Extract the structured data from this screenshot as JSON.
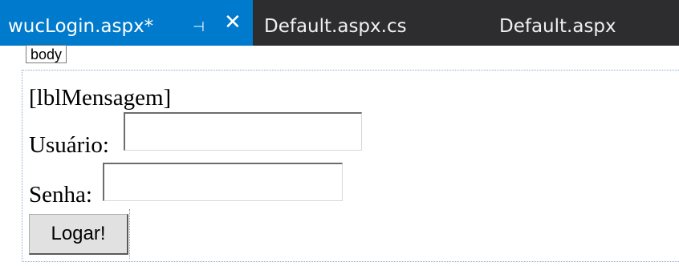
{
  "tabs": [
    {
      "label": "wucLogin.aspx*",
      "active": true,
      "pin_icon": "pin-icon",
      "close_icon": "close-icon"
    },
    {
      "label": "Default.aspx.cs",
      "active": false
    },
    {
      "label": "Default.aspx",
      "active": false
    }
  ],
  "designer": {
    "tag_label": "body",
    "message_label": "[lblMensagem]",
    "user_label": "Usuário:",
    "user_value": "",
    "password_label": "Senha:",
    "password_value": "",
    "submit_label": "Logar!"
  },
  "colors": {
    "tab_bar": "#2d2d30",
    "active_tab": "#007acc",
    "designer_bg": "#ffffff"
  }
}
